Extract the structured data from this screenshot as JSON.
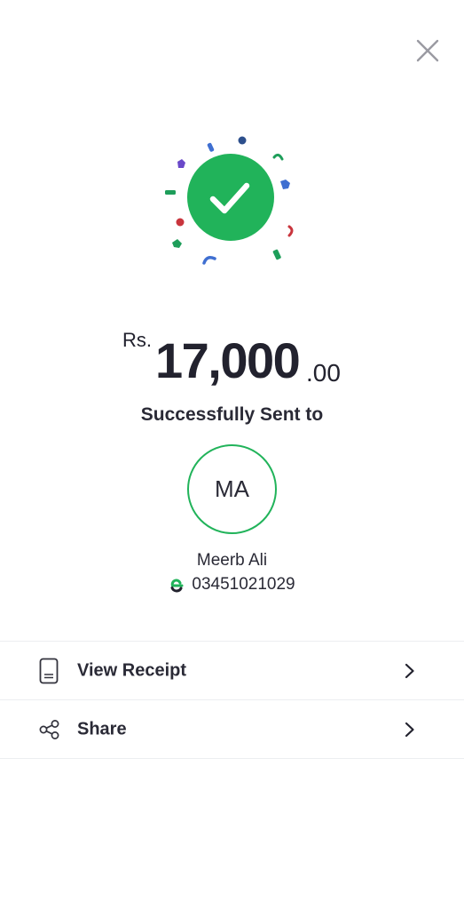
{
  "header": {
    "close_icon": "close-icon"
  },
  "colors": {
    "success_green": "#21b35a",
    "text_dark": "#22222e",
    "divider": "#eceef0"
  },
  "transaction": {
    "currency": "Rs.",
    "amount_whole": "17,000",
    "amount_decimal": ".00",
    "status": "Successfully Sent to"
  },
  "recipient": {
    "initials": "MA",
    "name": "Meerb Ali",
    "phone": "03451021029",
    "wallet_icon": "easypaisa-icon"
  },
  "actions": [
    {
      "label": "View Receipt",
      "icon": "receipt-icon"
    },
    {
      "label": "Share",
      "icon": "share-icon"
    }
  ]
}
